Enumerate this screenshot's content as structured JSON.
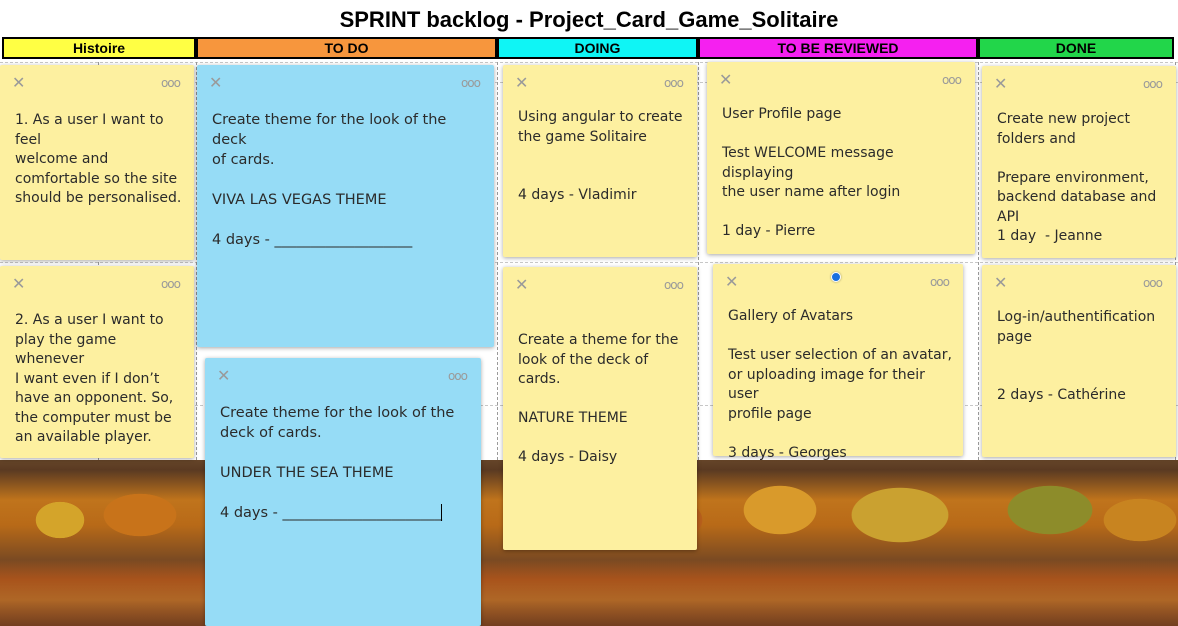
{
  "title": "SPRINT backlog - Project_Card_Game_Solitaire",
  "columns": [
    {
      "label": "Histoire",
      "color": "#ffff44"
    },
    {
      "label": "TO DO",
      "color": "#f7963d"
    },
    {
      "label": "DOING",
      "color": "#0ff5f5"
    },
    {
      "label": "TO BE REVIEWED",
      "color": "#f520f0"
    },
    {
      "label": "DONE",
      "color": "#22d64a"
    }
  ],
  "notes": {
    "story1": "1. As a user I want to feel\nwelcome and\ncomfortable so the site\nshould be personalised.",
    "story2": "2. As a user I want to\nplay the game whenever\nI want even if I don’t\nhave an opponent. So,\nthe computer must be\nan available player.",
    "todo1": "Create theme for the look of the deck\nof cards.\n\nVIVA LAS VEGAS THEME\n\n4 days - ___________________",
    "todo2": "Create theme for the look of the\ndeck of cards.\n\nUNDER THE SEA THEME\n\n4 days - ______________________",
    "doing1": "Using angular to create\nthe game Solitaire\n\n\n4 days - Vladimir",
    "doing2": "Create a theme for the\nlook of the deck of\ncards.\n\nNATURE THEME\n\n4 days - Daisy",
    "review1": "User Profile page\n\nTest WELCOME message displaying\nthe user name after login\n\n1 day - Pierre",
    "review2": "Gallery of Avatars\n\nTest user selection of an avatar,\nor uploading image for their user\nprofile page\n\n3 days - Georges",
    "done1": "Create new project\nfolders and\n\nPrepare environment,\nbackend database and\nAPI\n1 day  - Jeanne",
    "done2": "Log-in/authentification\npage\n\n\n2 days - Cathérine"
  },
  "icons": {
    "close": "close-icon",
    "menu": "more-options-icon"
  }
}
